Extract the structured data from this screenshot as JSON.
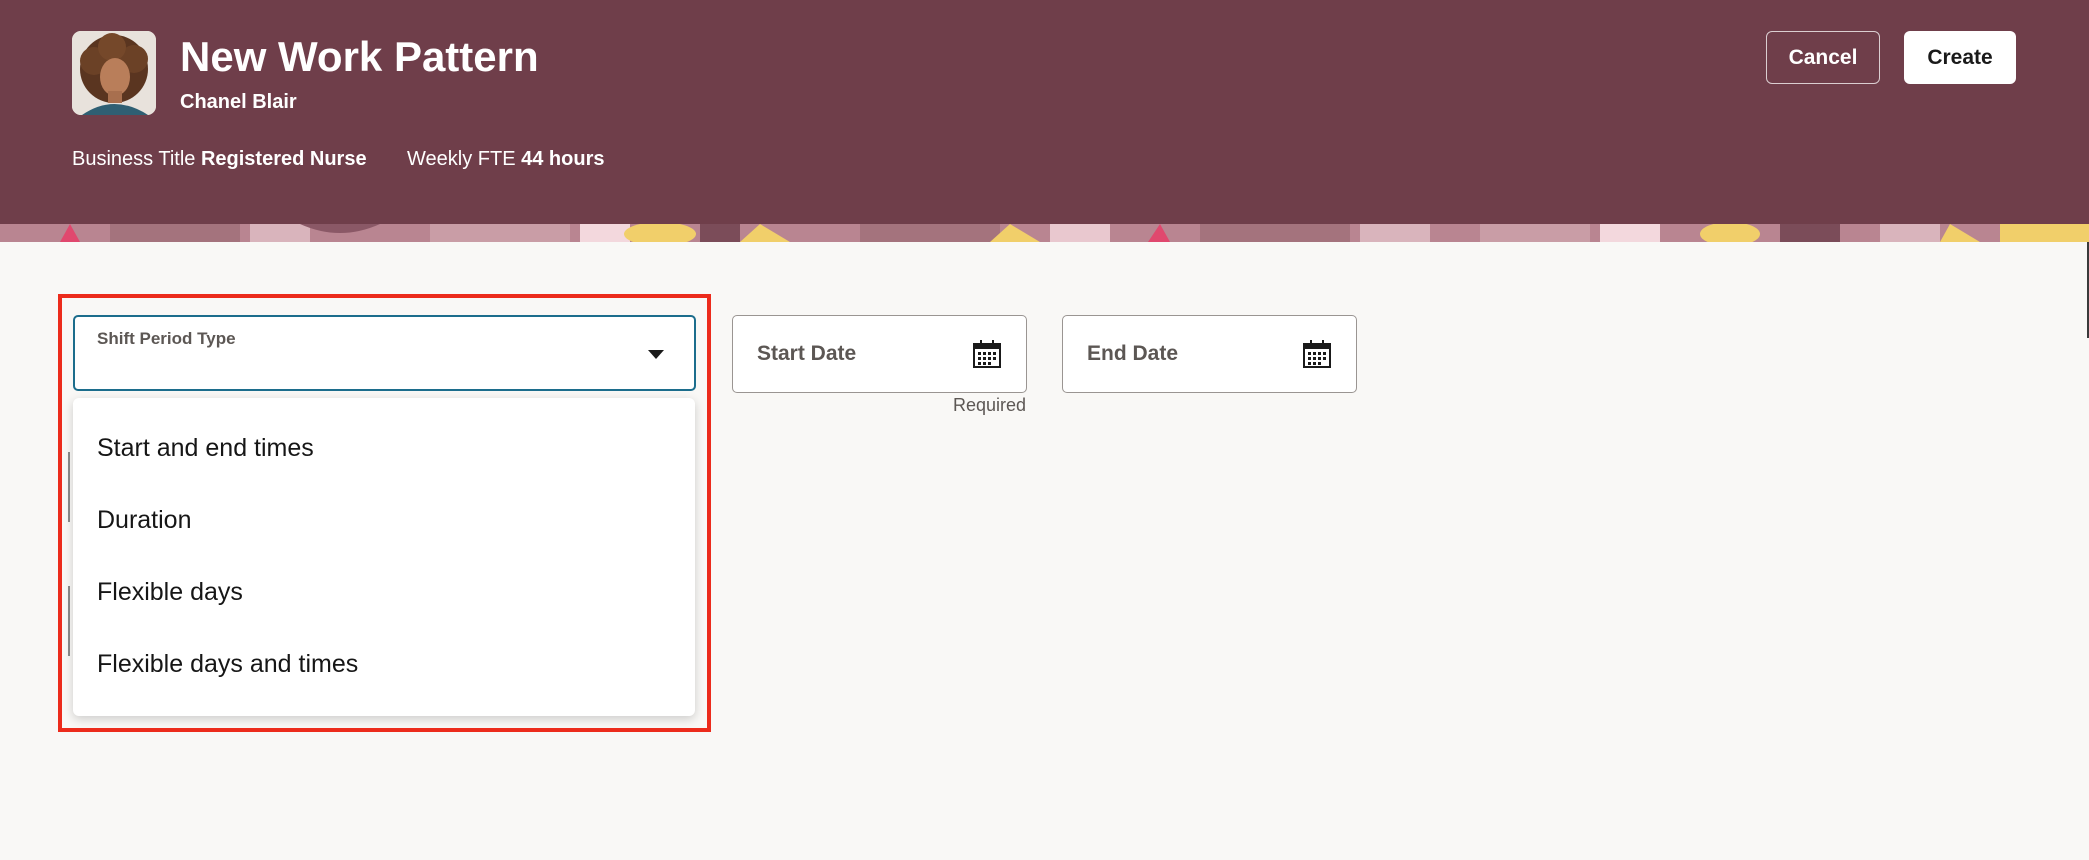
{
  "header": {
    "title": "New Work Pattern",
    "person_name": "Chanel Blair",
    "business_title_label": "Business Title",
    "business_title_value": "Registered Nurse",
    "fte_label": "Weekly FTE",
    "fte_value": "44 hours",
    "cancel_label": "Cancel",
    "create_label": "Create",
    "background_color": "#6f3e4a"
  },
  "form": {
    "shift_period_type": {
      "label": "Shift Period Type",
      "value": "",
      "options": [
        "Start and end times",
        "Duration",
        "Flexible days",
        "Flexible days and times"
      ]
    },
    "start_date": {
      "placeholder": "Start Date",
      "hint": "Required",
      "icon": "calendar-icon"
    },
    "end_date": {
      "placeholder": "End Date",
      "icon": "calendar-icon"
    }
  },
  "colors": {
    "highlight": "#ec2b1c",
    "focus": "#1c6d8c",
    "page": "#f9f8f6"
  }
}
